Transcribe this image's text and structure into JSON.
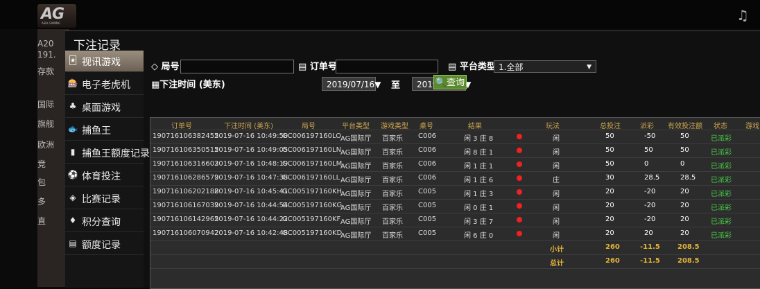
{
  "logo": {
    "text": "AG",
    "sub": "ASIA GAMING"
  },
  "left_strip": [
    "A20",
    "191.",
    "存款",
    "",
    "国际",
    "旗舰",
    "欧洲",
    "竞",
    "包",
    "多",
    "直",
    ""
  ],
  "dialog_title": "下注记录",
  "sidebar": [
    {
      "label": "视讯游戏",
      "icon": "cards-icon"
    },
    {
      "label": "电子老虎机",
      "icon": "slot-icon"
    },
    {
      "label": "桌面游戏",
      "icon": "chip-icon"
    },
    {
      "label": "捕鱼王",
      "icon": "fish-icon"
    },
    {
      "label": "捕鱼王额度记录",
      "icon": "document-icon"
    },
    {
      "label": "体育投注",
      "icon": "sports-icon"
    },
    {
      "label": "比赛记录",
      "icon": "diamond-icon"
    },
    {
      "label": "积分查询",
      "icon": "gem-icon"
    },
    {
      "label": "额度记录",
      "icon": "ledger-icon"
    }
  ],
  "filters": {
    "round_label": "局号",
    "order_label": "订单号",
    "platform_label": "平台类型",
    "platform_value": "1.全部",
    "time_label": "下注时间 (美东)",
    "date_from": "2019/07/16▼",
    "to_label": "至",
    "date_to": "2019/07/16▼",
    "query_label": "查询"
  },
  "table": {
    "headers": [
      "订单号",
      "下注时间 (美东)",
      "局号",
      "平台类型",
      "游戏类型",
      "桌号",
      "结果",
      "",
      "玩法",
      "总投注",
      "派彩",
      "有效投注额",
      "状态",
      "游戏"
    ],
    "rows": [
      [
        "190716106382455",
        "2019-07-16 10:49:50",
        "GC006197160LO",
        "AG国际厅",
        "百家乐",
        "C006",
        "闲 3 庄 8",
        "闲",
        "50",
        "-50",
        "50",
        "已派彩"
      ],
      [
        "190716106350515",
        "2019-07-16 10:49:05",
        "GC006197160LN",
        "AG国际厅",
        "百家乐",
        "C006",
        "闲 8 庄 1",
        "闲",
        "50",
        "50",
        "50",
        "已派彩"
      ],
      [
        "190716106316603",
        "2019-07-16 10:48:19",
        "GC006197160LM",
        "AG国际厅",
        "百家乐",
        "C006",
        "闲 1 庄 1",
        "闲",
        "50",
        "0",
        "0",
        "已派彩"
      ],
      [
        "190716106286579",
        "2019-07-16 10:47:38",
        "GC006197160LL",
        "AG国际厅",
        "百家乐",
        "C006",
        "闲 1 庄 6",
        "庄",
        "30",
        "28.5",
        "28.5",
        "已派彩"
      ],
      [
        "190716106202188",
        "2019-07-16 10:45:41",
        "GC005197160KH",
        "AG国际厅",
        "百家乐",
        "C005",
        "闲 1 庄 3",
        "闲",
        "20",
        "-20",
        "20",
        "已派彩"
      ],
      [
        "190716106167039",
        "2019-07-16 10:44:54",
        "GC005197160KG",
        "AG国际厅",
        "百家乐",
        "C005",
        "闲 0 庄 1",
        "闲",
        "20",
        "-20",
        "20",
        "已派彩"
      ],
      [
        "190716106142965",
        "2019-07-16 10:44:22",
        "GC005197160KF",
        "AG国际厅",
        "百家乐",
        "C005",
        "闲 3 庄 7",
        "闲",
        "20",
        "-20",
        "20",
        "已派彩"
      ],
      [
        "190716106070942",
        "2019-07-16 10:42:48",
        "GC005197160KD",
        "AG国际厅",
        "百家乐",
        "C005",
        "闲 6 庄 0",
        "闲",
        "20",
        "20",
        "20",
        "已派彩"
      ]
    ],
    "payout_color": [
      "green",
      "red",
      "white",
      "red",
      "green",
      "green",
      "green",
      "red"
    ],
    "subtotal": {
      "label": "小计",
      "total": "260",
      "payout": "-11.5",
      "valid": "208.5"
    },
    "grandtotal": {
      "label": "总计",
      "total": "260",
      "payout": "-11.5",
      "valid": "208.5"
    }
  }
}
